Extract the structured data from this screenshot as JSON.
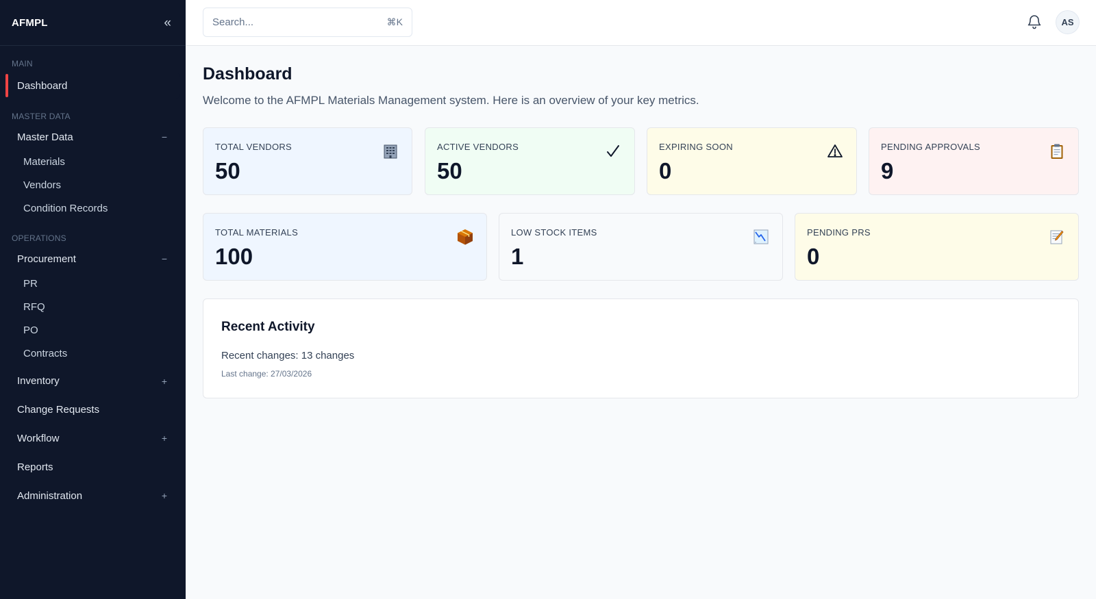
{
  "sidebar": {
    "brand": "AFMPL",
    "collapse_icon": "«",
    "sections": {
      "main": "MAIN",
      "master_data": "MASTER DATA",
      "operations": "OPERATIONS"
    },
    "items": {
      "dashboard": "Dashboard",
      "master_data": "Master Data",
      "materials": "Materials",
      "vendors": "Vendors",
      "condition_records": "Condition Records",
      "procurement": "Procurement",
      "pr": "PR",
      "rfq": "RFQ",
      "po": "PO",
      "contracts": "Contracts",
      "inventory": "Inventory",
      "change_requests": "Change Requests",
      "workflow": "Workflow",
      "reports": "Reports",
      "administration": "Administration"
    },
    "toggles": {
      "expanded": "−",
      "collapsed": "+"
    },
    "accent": "#ef4444",
    "background": "#0f172a"
  },
  "topbar": {
    "search_placeholder": "Search...",
    "search_shortcut": "⌘K",
    "bell_icon": "bell-icon",
    "avatar_initials": "AS"
  },
  "main": {
    "title": "Dashboard",
    "subtitle": "Welcome to the AFMPL Materials Management system. Here is an overview of your key metrics.",
    "stats_row1": [
      {
        "label": "TOTAL VENDORS",
        "value": "50",
        "icon": "🏢",
        "icon_name": "building-icon",
        "bg": "#eff6ff"
      },
      {
        "label": "ACTIVE VENDORS",
        "value": "50",
        "icon": "✓",
        "icon_name": "checkmark-icon",
        "bg": "#f0fdf4"
      },
      {
        "label": "EXPIRING SOON",
        "value": "0",
        "icon": "⚠",
        "icon_name": "warning-icon",
        "bg": "#fefce8"
      },
      {
        "label": "PENDING APPROVALS",
        "value": "9",
        "icon": "📋",
        "icon_name": "clipboard-icon",
        "bg": "#fef2f2"
      }
    ],
    "stats_row2": [
      {
        "label": "TOTAL MATERIALS",
        "value": "100",
        "icon": "📦",
        "icon_name": "package-icon",
        "bg": "#eff6ff"
      },
      {
        "label": "LOW STOCK ITEMS",
        "value": "1",
        "icon": "📉",
        "icon_name": "chart-down-icon",
        "bg": "#f8fafc"
      },
      {
        "label": "PENDING PRS",
        "value": "0",
        "icon": "📝",
        "icon_name": "memo-icon",
        "bg": "#fefce8"
      }
    ],
    "recent_activity": {
      "title": "Recent Activity",
      "summary": "Recent changes: 13 changes",
      "last_change": "Last change: 27/03/2026"
    }
  }
}
